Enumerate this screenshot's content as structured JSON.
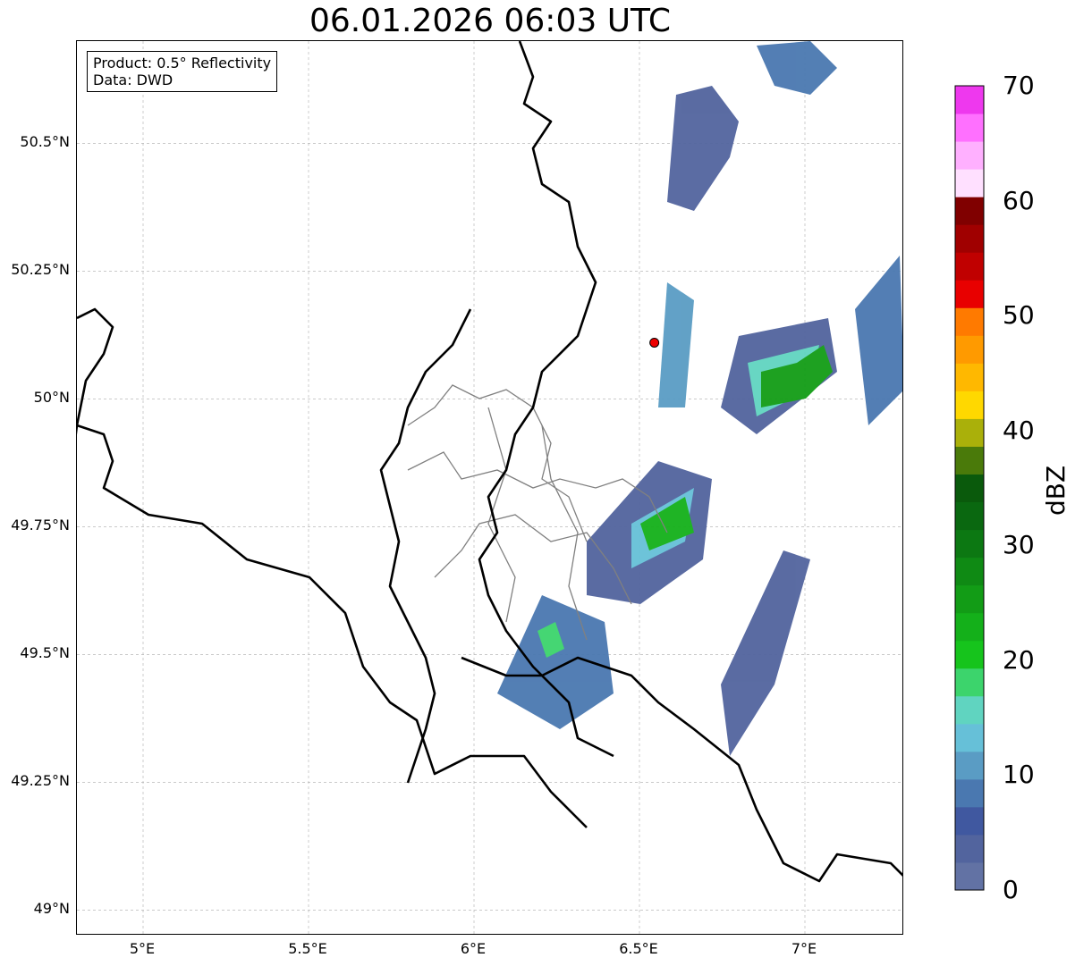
{
  "title": "06.01.2026 06:03 UTC",
  "info": {
    "product": "Product: 0.5° Reflectivity",
    "data": "Data: DWD"
  },
  "axes": {
    "lat_ticks": [
      {
        "value": 50.5,
        "label": "50.5°N"
      },
      {
        "value": 50.25,
        "label": "50.25°N"
      },
      {
        "value": 50.0,
        "label": "50°N"
      },
      {
        "value": 49.75,
        "label": "49.75°N"
      },
      {
        "value": 49.5,
        "label": "49.5°N"
      },
      {
        "value": 49.25,
        "label": "49.25°N"
      },
      {
        "value": 49.0,
        "label": "49°N"
      }
    ],
    "lon_ticks": [
      {
        "value": 5.0,
        "label": "5°E"
      },
      {
        "value": 5.5,
        "label": "5.5°E"
      },
      {
        "value": 6.0,
        "label": "6°E"
      },
      {
        "value": 6.5,
        "label": "6.5°E"
      },
      {
        "value": 7.0,
        "label": "7°E"
      }
    ],
    "lon_range": [
      4.8,
      7.3
    ],
    "lat_range": [
      48.95,
      50.7
    ]
  },
  "colorbar": {
    "title": "dBZ",
    "ticks": [
      "0",
      "10",
      "20",
      "30",
      "40",
      "50",
      "60",
      "70"
    ],
    "colors": [
      "#6272a4",
      "#52649e",
      "#4058a0",
      "#4a78b0",
      "#5a9cc4",
      "#66c0d8",
      "#60d4c0",
      "#3cd46c",
      "#16c41c",
      "#14b01a",
      "#129c16",
      "#0f8a14",
      "#0c7812",
      "#0a6810",
      "#0a5a0c",
      "#4a7a0a",
      "#aab00a",
      "#ffd800",
      "#ffb800",
      "#ff9a00",
      "#ff7a00",
      "#e80000",
      "#c00000",
      "#a00000",
      "#800000",
      "#ffe0ff",
      "#ffb0ff",
      "#ff70ff",
      "#ee38ee"
    ]
  },
  "radar_marker": {
    "lon": 6.545,
    "lat": 50.11,
    "color": "#ee0000"
  }
}
